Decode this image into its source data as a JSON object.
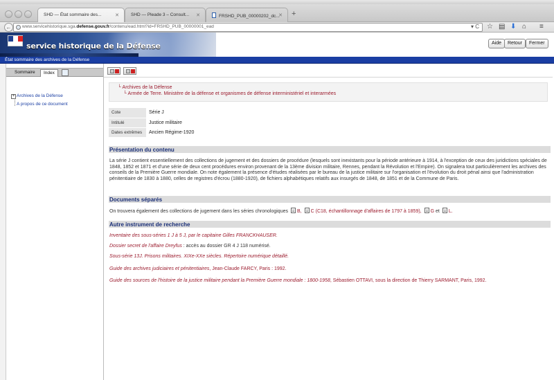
{
  "browser": {
    "tabs": [
      {
        "label": "SHD — État sommaire des...",
        "active": true
      },
      {
        "label": "SHD — Pleade 3 – Consult...",
        "active": false
      },
      {
        "label": "FRSHD_PUB_00000202_dc...",
        "active": false
      }
    ],
    "url": {
      "prefix": "www.servicehistorique.sga.",
      "domain": "defense.gouv.fr",
      "path": "/contenu/ead.html?id=FRSHD_PUB_00000001_ead"
    }
  },
  "header": {
    "site_title": "service historique de la Défense",
    "buttons": {
      "help": "Aide",
      "back": "Retour",
      "close": "Fermer"
    }
  },
  "title_bar": "État sommaire des archives de la Défense",
  "sidebar": {
    "tabs": {
      "summary": "Sommaire",
      "index": "Index"
    },
    "tree": {
      "root": "Archives de la Défense",
      "about": "A propos de ce document"
    }
  },
  "breadcrumb": {
    "level1": "Archives de la Défense",
    "level2": "Armée de Terre. Ministère de la défense et organismes de défense interministériel et interarmées"
  },
  "info": {
    "cote_label": "Cote",
    "cote_value": "Série J",
    "intitule_label": "Intitulé",
    "intitule_value": "Justice militaire",
    "dates_label": "Dates extrêmes",
    "dates_value": "Ancien Régime-1920"
  },
  "sections": {
    "presentation": {
      "title": "Présentation du contenu",
      "text": "La série J contient essentiellement des collections de jugement et des dossiers de procédure (lesquels sont inexistants pour la période antérieure à 1914, à l'exception de ceux des juridictions spéciales de 1848, 1852 et 1871 et d'une série de deux cent procédures environ provenant de la 13ème division militaire, Rennes, pendant la Révolution et l'Empire). On signalera tout particulièrement les archives des conseils de la Première Guerre mondiale. On note également la présence d'études réalisées par le bureau de la justice militaire sur l'organisation et l'évolution du droit pénal ainsi que l'administration pénitentiaire de 1830 à 1880, celles de registres d'écrou (1880-1920), de fichiers alphabétiques relatifs aux insurgés de 1848, de 1851 et de la Commune de Paris."
    },
    "documents": {
      "title": "Documents séparés",
      "intro": "On trouvera également des collections de jugement dans les séries chronologiques",
      "link_b": "B,",
      "link_c": "C (C18, échantillonnage d'affaires de 1797 à 1859),",
      "link_g": "G",
      "et": "et",
      "link_l": "L."
    },
    "research": {
      "title": "Autre instrument de recherche",
      "items": [
        {
          "italic": "Inventaire des sous-séries 1 J à 5 J, par le capitaine Gilles FRANCKHAUSER.",
          "plain": ""
        },
        {
          "italic": "Dossier secret de l'affaire Dreyfus",
          "plain": " : accès au dossier GR 4 J 118 numérisé."
        },
        {
          "italic": "Sous-série 13J. Prisons militaires. XIXe-XXe siècles. Répertoire numérique détaillé.",
          "plain": ""
        },
        {
          "italic": "Guide des archives judiciaires et pénitentiaires",
          "plain": ", Jean-Claude FARCY, Paris : 1992."
        },
        {
          "italic": "Guide des sources de l'histoire de la justice militaire pendant la Première Guerre mondiale : 1800-1958",
          "plain": ", Sébastien OTTAVI, sous la direction de Thierry SARMANT, Paris, 1992."
        }
      ]
    }
  },
  "colors": {
    "title_bar": "#1a3ea3",
    "link": "#9b1b2d",
    "section_text": "#1a2f78"
  }
}
